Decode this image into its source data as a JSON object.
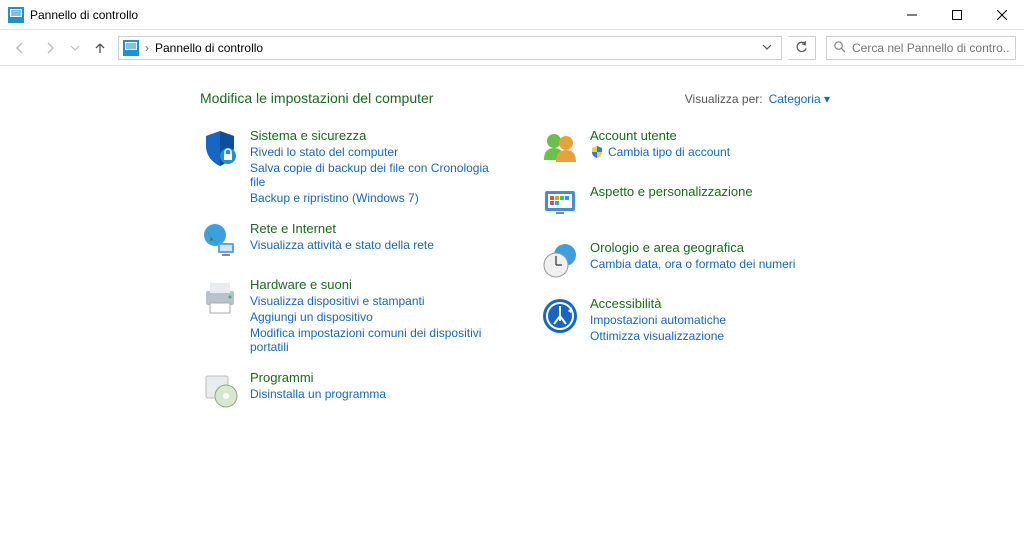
{
  "window": {
    "title": "Pannello di controllo"
  },
  "breadcrumb": {
    "current": "Pannello di controllo"
  },
  "search": {
    "placeholder": "Cerca nel Pannello di contro..."
  },
  "page": {
    "heading": "Modifica le impostazioni del computer"
  },
  "viewBy": {
    "label": "Visualizza per:",
    "value": "Categoria"
  },
  "left": {
    "system": {
      "title": "Sistema e sicurezza",
      "links": [
        "Rivedi lo stato del computer",
        "Salva copie di backup dei file con Cronologia file",
        "Backup e ripristino (Windows 7)"
      ]
    },
    "network": {
      "title": "Rete e Internet",
      "links": [
        "Visualizza attività e stato della rete"
      ]
    },
    "hardware": {
      "title": "Hardware e suoni",
      "links": [
        "Visualizza dispositivi e stampanti",
        "Aggiungi un dispositivo",
        "Modifica impostazioni comuni dei dispositivi portatili"
      ]
    },
    "programs": {
      "title": "Programmi",
      "links": [
        "Disinstalla un programma"
      ]
    }
  },
  "right": {
    "accounts": {
      "title": "Account utente",
      "links": [
        "Cambia tipo di account"
      ]
    },
    "appearance": {
      "title": "Aspetto e personalizzazione"
    },
    "clock": {
      "title": "Orologio e area geografica",
      "links": [
        "Cambia data, ora o formato dei numeri"
      ]
    },
    "ease": {
      "title": "Accessibilità",
      "links": [
        "Impostazioni automatiche",
        "Ottimizza visualizzazione"
      ]
    }
  }
}
